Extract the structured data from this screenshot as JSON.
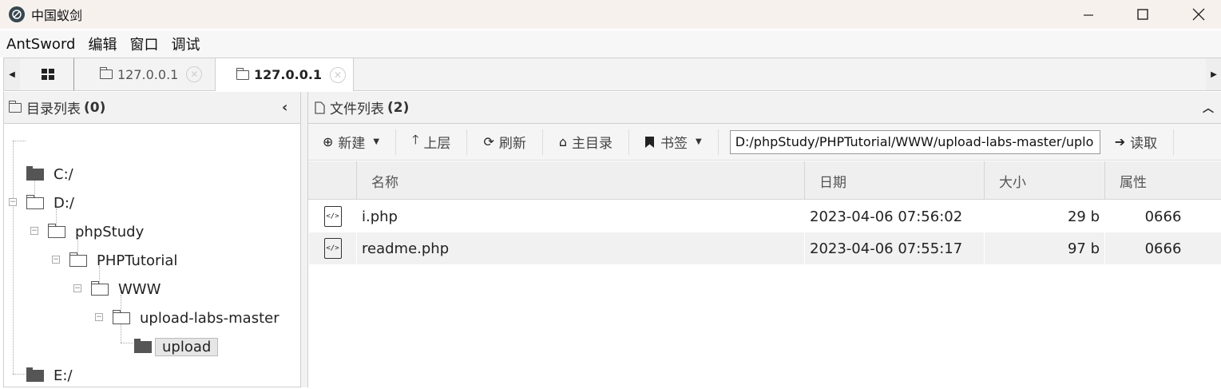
{
  "window": {
    "title": "中国蚁剑"
  },
  "menu": {
    "items": [
      "AntSword",
      "编辑",
      "窗口",
      "调试"
    ]
  },
  "tabs": [
    {
      "label": "127.0.0.1",
      "active": false
    },
    {
      "label": "127.0.0.1",
      "active": true
    }
  ],
  "left_panel": {
    "title": "目录列表",
    "count": "(0)"
  },
  "tree": {
    "c": "C:/",
    "d": "D:/",
    "phpstudy": "phpStudy",
    "phptutorial": "PHPTutorial",
    "www": "WWW",
    "uploadlabs": "upload-labs-master",
    "upload": "upload",
    "e": "E:/"
  },
  "right_panel": {
    "title": "文件列表",
    "count": "(2)"
  },
  "toolbar": {
    "new_label": "新建",
    "up_label": "上层",
    "refresh_label": "刷新",
    "home_label": "主目录",
    "bookmark_label": "书签",
    "path_value": "D:/phpStudy/PHPTutorial/WWW/upload-labs-master/uplo",
    "read_label": "读取"
  },
  "columns": [
    "名称",
    "日期",
    "大小",
    "属性"
  ],
  "files": [
    {
      "name": "i.php",
      "date": "2023-04-06 07:56:02",
      "size": "29 b",
      "attr": "0666"
    },
    {
      "name": "readme.php",
      "date": "2023-04-06 07:55:17",
      "size": "97 b",
      "attr": "0666"
    }
  ]
}
